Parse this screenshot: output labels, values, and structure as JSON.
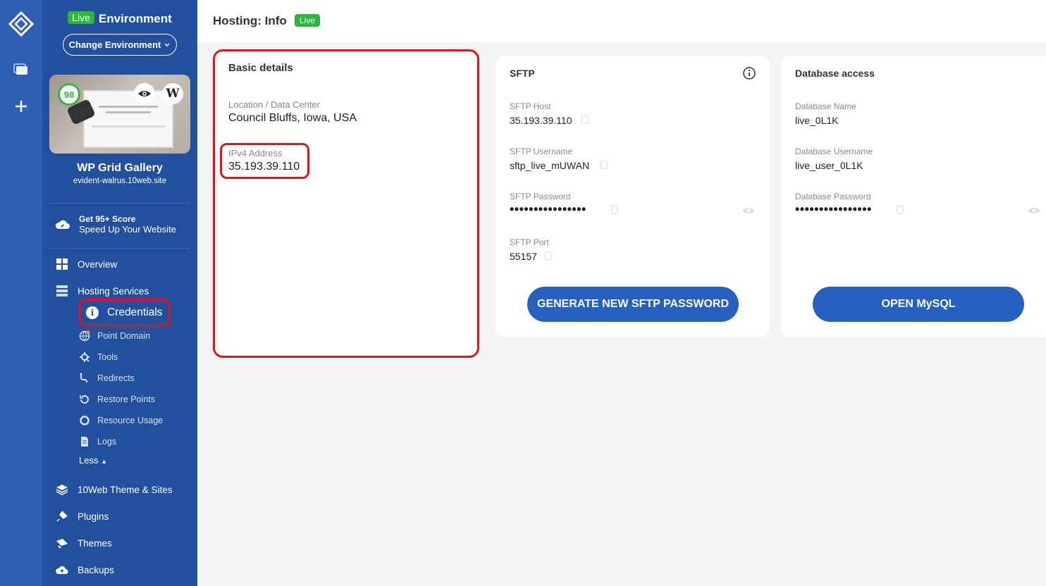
{
  "sidebar": {
    "env_badge": "Live",
    "env_title": "Environment",
    "change_env": "Change Environment",
    "score": "98",
    "site_name": "WP Grid Gallery",
    "site_url": "evident-walrus.10web.site",
    "promo_line1": "Get 95+ Score",
    "promo_line2": "Speed Up Your Website",
    "overview": "Overview",
    "hosting_services": "Hosting Services",
    "credentials": "Credentials",
    "sub_items": [
      "Point Domain",
      "Tools",
      "Redirects",
      "Restore Points",
      "Resource Usage",
      "Logs"
    ],
    "less": "Less",
    "theme_sites": "10Web Theme & Sites",
    "plugins": "Plugins",
    "themes": "Themes",
    "backups": "Backups"
  },
  "header": {
    "title": "Hosting: Info",
    "badge": "Live"
  },
  "basic": {
    "title": "Basic details",
    "location_label": "Location / Data Center",
    "location_value": "Council Bluffs, Iowa, USA",
    "ipv4_label": "IPv4 Address",
    "ipv4_value": "35.193.39.110"
  },
  "sftp": {
    "title": "SFTP",
    "host_label": "SFTP Host",
    "host_value": "35.193.39.110",
    "username_label": "SFTP Username",
    "username_value": "sftp_live_mUWAN",
    "password_label": "SFTP Password",
    "password_value": "••••••••••••••••",
    "port_label": "SFTP Port",
    "port_value": "55157",
    "button": "GENERATE NEW SFTP PASSWORD"
  },
  "db": {
    "title": "Database access",
    "name_label": "Database Name",
    "name_value": "live_0L1K",
    "username_label": "Database Username",
    "username_value": "live_user_0L1K",
    "password_label": "Database Password",
    "password_value": "••••••••••••••••",
    "button": "OPEN MySQL"
  },
  "colors": {
    "sidebar": "#22509f",
    "rail": "#2e5fb4",
    "live_green": "#2db83d",
    "button_blue": "#2660c0",
    "highlight_red": "#e5101a"
  }
}
